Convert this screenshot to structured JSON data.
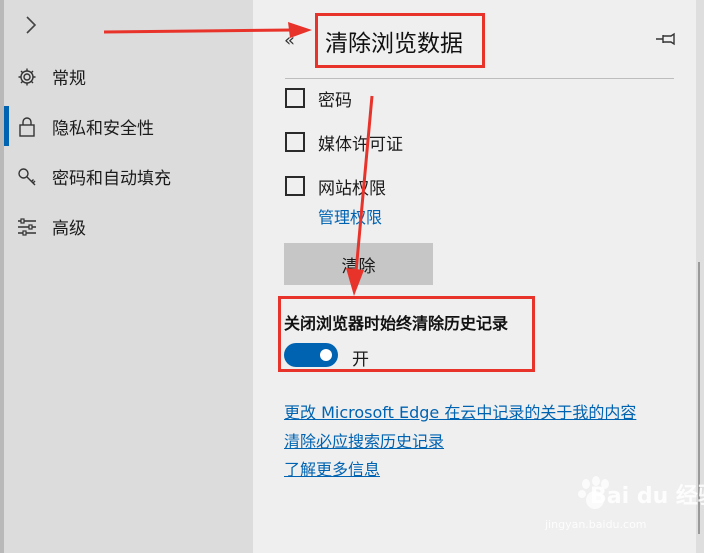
{
  "sidebar": {
    "items": [
      {
        "label": "常规",
        "icon": "gear-icon"
      },
      {
        "label": "隐私和安全性",
        "icon": "lock-icon"
      },
      {
        "label": "密码和自动填充",
        "icon": "key-icon"
      },
      {
        "label": "高级",
        "icon": "sliders-icon"
      }
    ],
    "active_index": 1,
    "expand_glyph": "›"
  },
  "panel": {
    "back_glyph": "«",
    "title": "清除浏览数据",
    "checkboxes": [
      {
        "label": "密码",
        "checked": false
      },
      {
        "label": "媒体许可证",
        "checked": false
      },
      {
        "label": "网站权限",
        "checked": false
      }
    ],
    "manage_link": "管理权限",
    "clear_button": "清除",
    "toggle": {
      "title": "关闭浏览器时始终清除历史记录",
      "state_label": "开",
      "on": true
    },
    "links": [
      "更改 Microsoft Edge 在云中记录的关于我的内容",
      "清除必应搜索历史记录",
      "了解更多信息"
    ]
  },
  "watermark": {
    "text": "Bai du 经验",
    "url": "jingyan.baidu.com"
  },
  "colors": {
    "accent": "#0063b1",
    "annotation": "#e8332b"
  }
}
